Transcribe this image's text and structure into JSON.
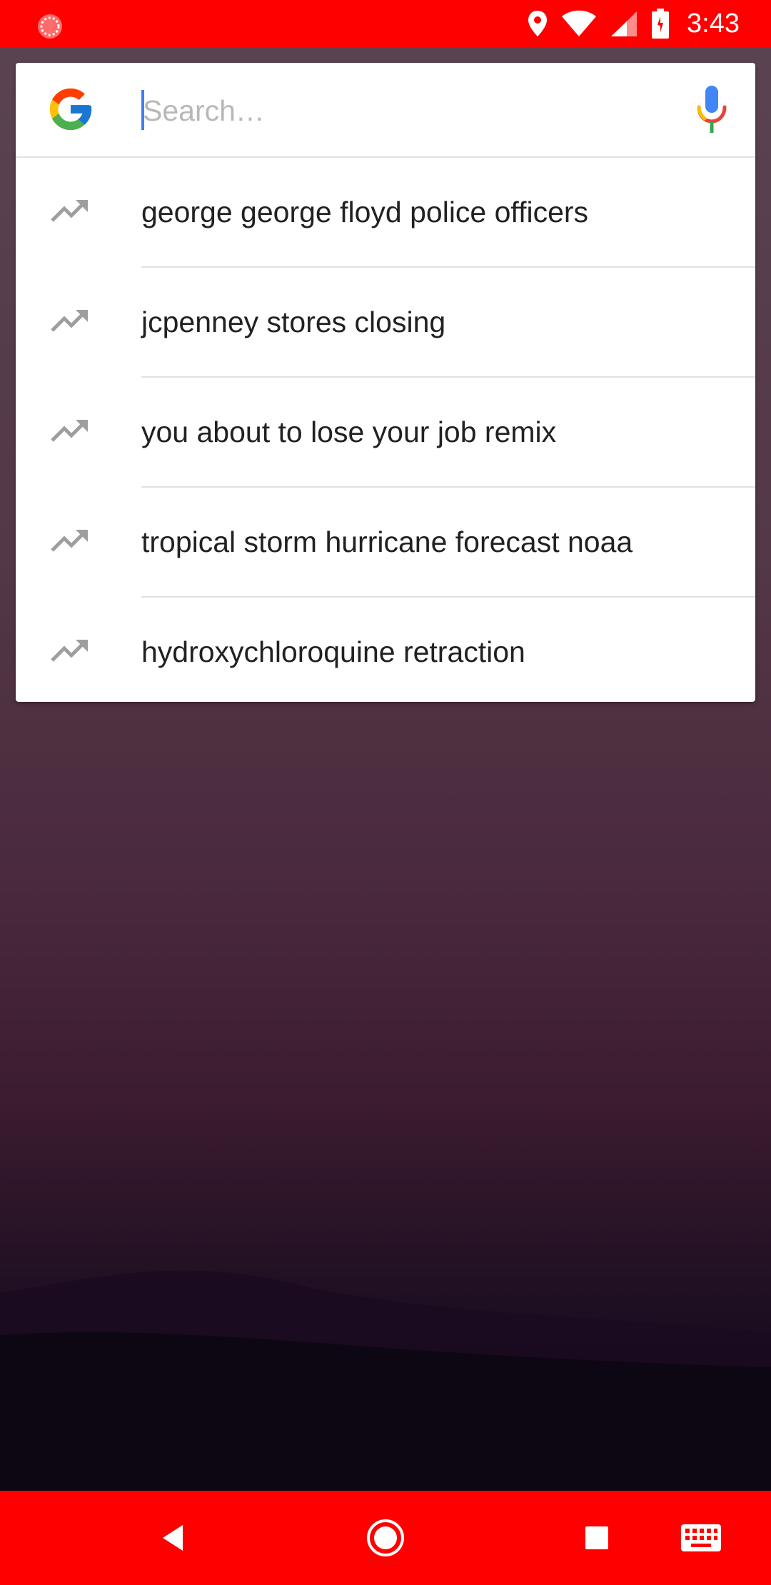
{
  "status_bar": {
    "time": "3:43",
    "icons": [
      "notification-icon",
      "location-icon",
      "wifi-icon",
      "signal-icon",
      "battery-charging-icon"
    ]
  },
  "search": {
    "placeholder": "Search…",
    "value": ""
  },
  "suggestions": [
    {
      "icon": "trending-icon",
      "text": "george george floyd police officers"
    },
    {
      "icon": "trending-icon",
      "text": "jcpenney stores closing"
    },
    {
      "icon": "trending-icon",
      "text": "you about to lose your job remix"
    },
    {
      "icon": "trending-icon",
      "text": "tropical storm hurricane forecast noaa"
    },
    {
      "icon": "trending-icon",
      "text": "hydroxychloroquine retraction"
    }
  ],
  "nav_bar": {
    "buttons": [
      "back-icon",
      "home-icon",
      "recents-icon",
      "keyboard-icon"
    ]
  },
  "colors": {
    "system_bars": "#ff0000",
    "accent": "#3d7ef5",
    "suggestion_text": "#212121",
    "trend_icon": "#9e9e9e"
  }
}
